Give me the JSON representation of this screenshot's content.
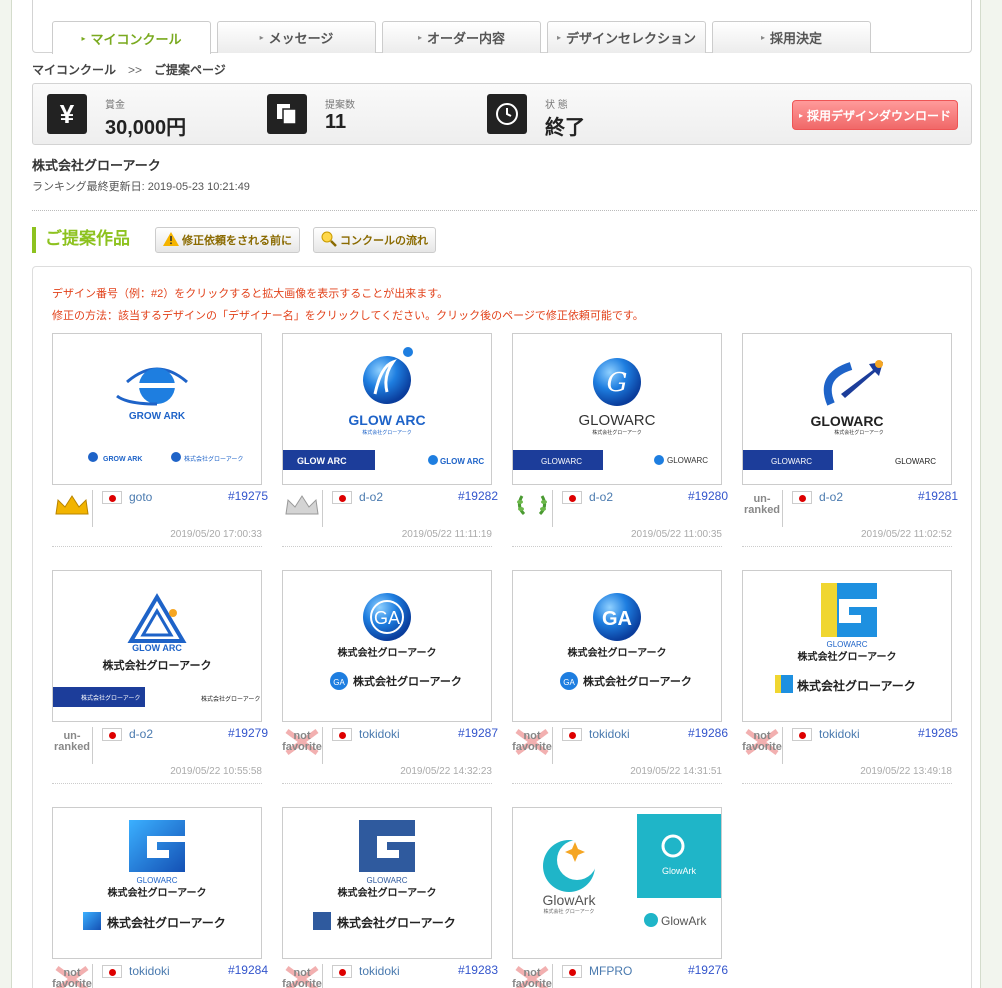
{
  "tabs": [
    "マイコンクール",
    "メッセージ",
    "オーダー内容",
    "デザインセレクション",
    "採用決定"
  ],
  "breadcrumb": {
    "home": "マイコンクール",
    "sep": ">>",
    "current": "ご提案ページ"
  },
  "stats": {
    "prize_label": "賞金",
    "prize_value": "30,000円",
    "count_label": "提案数",
    "count_value": "11",
    "status_label": "状 態",
    "status_value": "終了",
    "download_button": "採用デザインダウンロード",
    "yen_symbol": "¥"
  },
  "company_name": "株式会社グローアーク",
  "ranking_updated": "ランキング最終更新日: 2019-05-23 10:21:49",
  "section_title": "ご提案作品",
  "help_buttons": [
    "修正依頼をされる前に",
    "コンクールの流れ"
  ],
  "notes": [
    "デザイン番号（例：#2）をクリックすると拡大画像を表示することが出来ます。",
    "修正の方法：該当するデザインの「デザイナー名」をクリックしてください。クリック後のページで修正依頼可能です。"
  ],
  "designs": [
    {
      "name": "goto",
      "num": "#19275",
      "date": "2019/05/20 17:00:33",
      "rank": "gold-crown",
      "logo": "GROW ARK",
      "sub": "株式会社グローアーク"
    },
    {
      "name": "d-o2",
      "num": "#19282",
      "date": "2019/05/22 11:11:19",
      "rank": "silver-crown",
      "logo": "GLOW ARC",
      "sub": "株式会社グローアーク"
    },
    {
      "name": "d-o2",
      "num": "#19280",
      "date": "2019/05/22 11:00:35",
      "rank": "laurel",
      "logo": "GLOWARC",
      "sub": "株式会社グローアーク"
    },
    {
      "name": "d-o2",
      "num": "#19281",
      "date": "2019/05/22 11:02:52",
      "rank": "un-ranked",
      "logo": "GLOWARC",
      "sub": "株式会社グローアーク"
    },
    {
      "name": "d-o2",
      "num": "#19279",
      "date": "2019/05/22 10:55:58",
      "rank": "un-ranked",
      "logo": "GLOW ARC",
      "sub": "株式会社グローアーク"
    },
    {
      "name": "tokidoki",
      "num": "#19287",
      "date": "2019/05/22 14:32:23",
      "rank": "not-favorite",
      "logo": "",
      "sub": "株式会社グローアーク"
    },
    {
      "name": "tokidoki",
      "num": "#19286",
      "date": "2019/05/22 14:31:51",
      "rank": "not-favorite",
      "logo": "",
      "sub": "株式会社グローアーク"
    },
    {
      "name": "tokidoki",
      "num": "#19285",
      "date": "2019/05/22 13:49:18",
      "rank": "not-favorite",
      "logo": "GLOWARC",
      "sub": "株式会社グローアーク"
    },
    {
      "name": "tokidoki",
      "num": "#19284",
      "date": "",
      "rank": "not-favorite",
      "logo": "GLOWARC",
      "sub": "株式会社グローアーク"
    },
    {
      "name": "tokidoki",
      "num": "#19283",
      "date": "",
      "rank": "not-favorite",
      "logo": "GLOWARC",
      "sub": "株式会社グローアーク"
    },
    {
      "name": "MFPRO",
      "num": "#19276",
      "date": "",
      "rank": "not-favorite",
      "logo": "GlowArk",
      "sub": "株式会社 グローアーク"
    }
  ],
  "rank_text": {
    "unranked_1": "un-",
    "unranked_2": "ranked",
    "notfav_1": "not",
    "notfav_2": "favorite"
  },
  "colors": {
    "accent": "#8dc21f",
    "link": "#3355cc",
    "note": "#e2421b",
    "download": "#f06868",
    "logo_blue": "#1e63c8",
    "logo_navy": "#1c3d9a",
    "teal": "#1fb5c8",
    "yellow": "#f0d630"
  }
}
